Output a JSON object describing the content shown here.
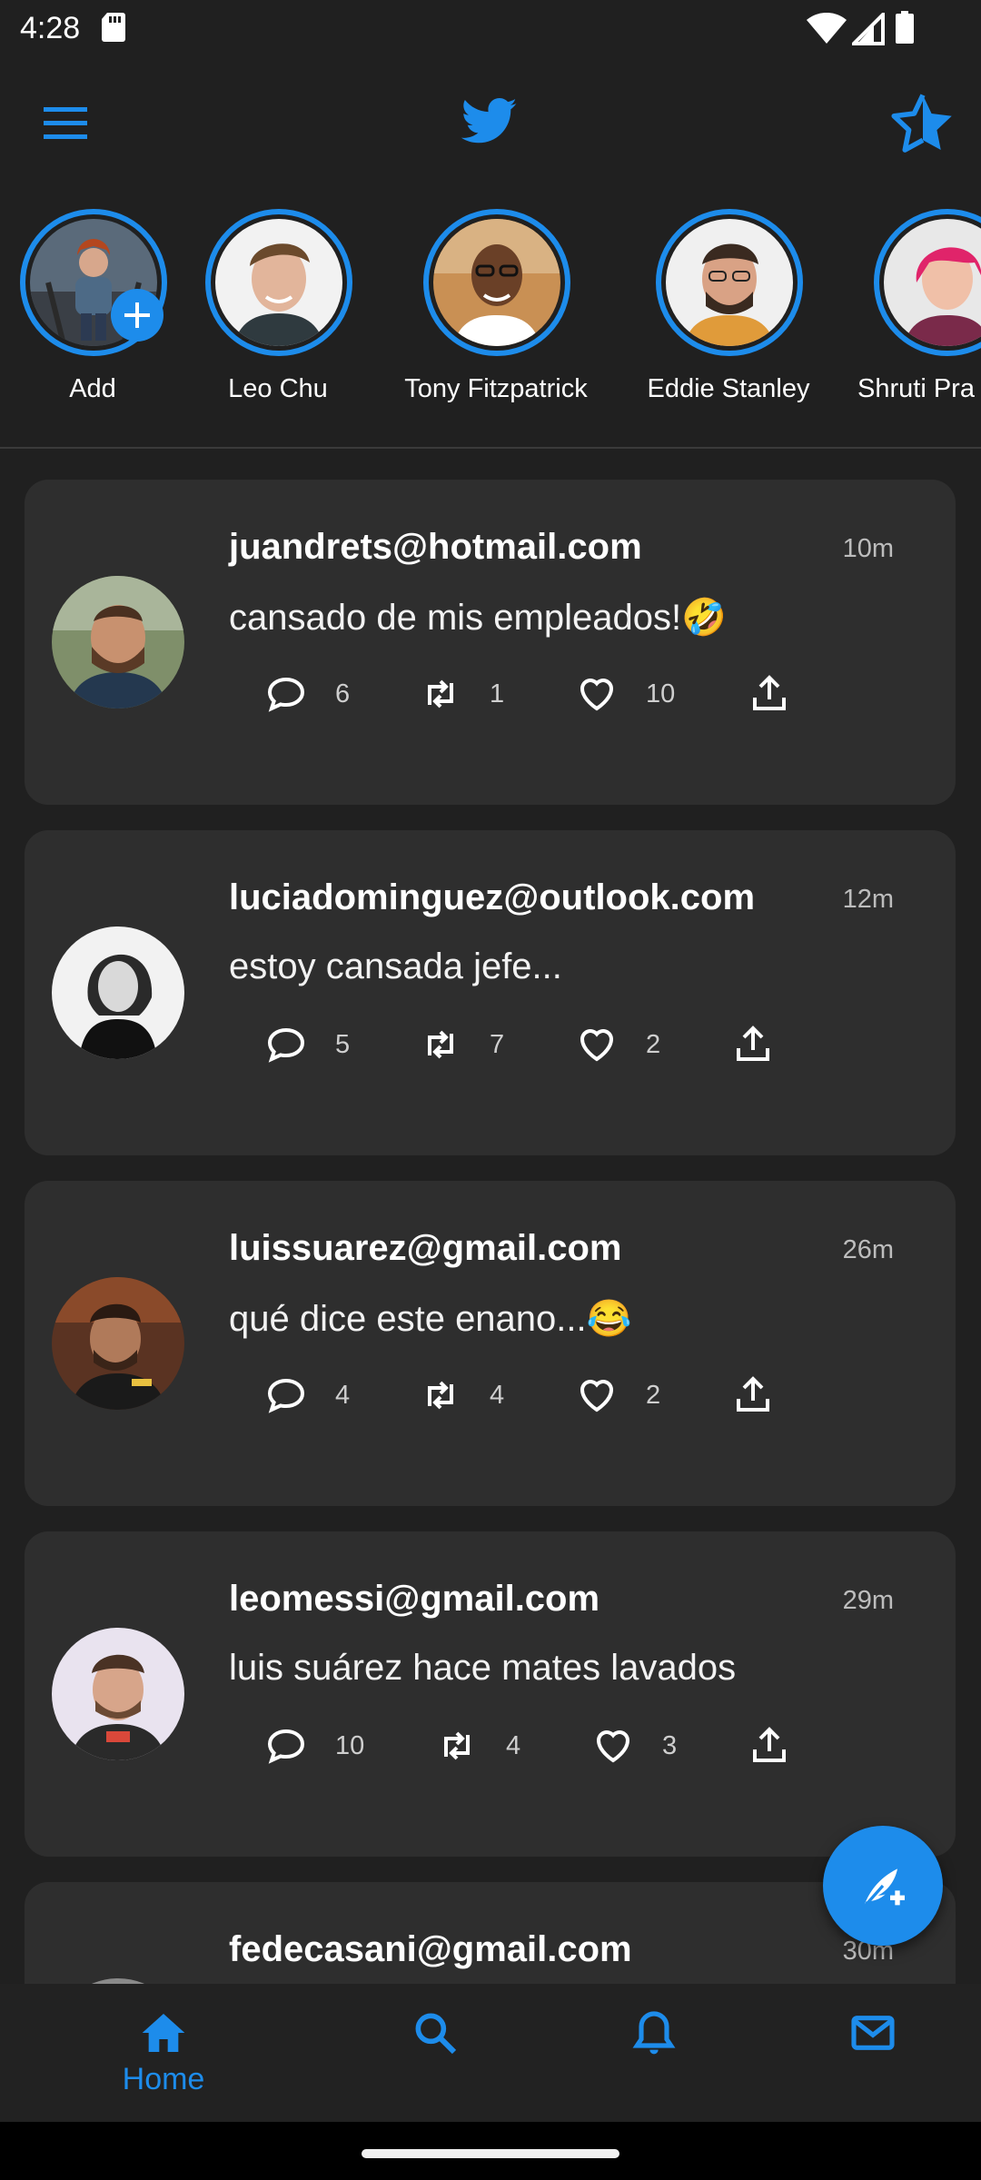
{
  "status_bar": {
    "time": "4:28",
    "icons": [
      "sd-card-icon",
      "wifi-icon",
      "signal-icon",
      "battery-icon"
    ]
  },
  "app_bar": {
    "left_icon": "menu-icon",
    "center_icon": "twitter-bird-icon",
    "right_icon": "star-icon"
  },
  "colors": {
    "accent": "#1d8ceb",
    "background": "#202020",
    "card": "#2e2e2e"
  },
  "stories": [
    {
      "name": "Add"
    },
    {
      "name": "Leo Chu"
    },
    {
      "name": "Tony Fitzpatrick"
    },
    {
      "name": "Eddie Stanley"
    },
    {
      "name": "Shruti Pra"
    }
  ],
  "tweets": [
    {
      "author": "juandrets@hotmail.com",
      "time": "10m",
      "text": "cansado de mis empleados!🤣",
      "replies": "6",
      "retweets": "1",
      "likes": "10"
    },
    {
      "author": "luciadominguez@outlook.com",
      "time": "12m",
      "text": "estoy cansada jefe...",
      "replies": "5",
      "retweets": "7",
      "likes": "2"
    },
    {
      "author": "luissuarez@gmail.com",
      "time": "26m",
      "text": "qué dice este enano...😂",
      "replies": "4",
      "retweets": "4",
      "likes": "2"
    },
    {
      "author": "leomessi@gmail.com",
      "time": "29m",
      "text": "luis suárez hace mates lavados",
      "replies": "10",
      "retweets": "4",
      "likes": "3"
    },
    {
      "author": "fedecasani@gmail.com",
      "time": "30m",
      "text": "",
      "replies": "",
      "retweets": "",
      "likes": ""
    }
  ],
  "fab": {
    "icon": "compose-feather-icon"
  },
  "bottom_nav": {
    "home_label": "Home",
    "items": [
      "home-icon",
      "search-icon",
      "bell-icon",
      "mail-icon"
    ]
  }
}
